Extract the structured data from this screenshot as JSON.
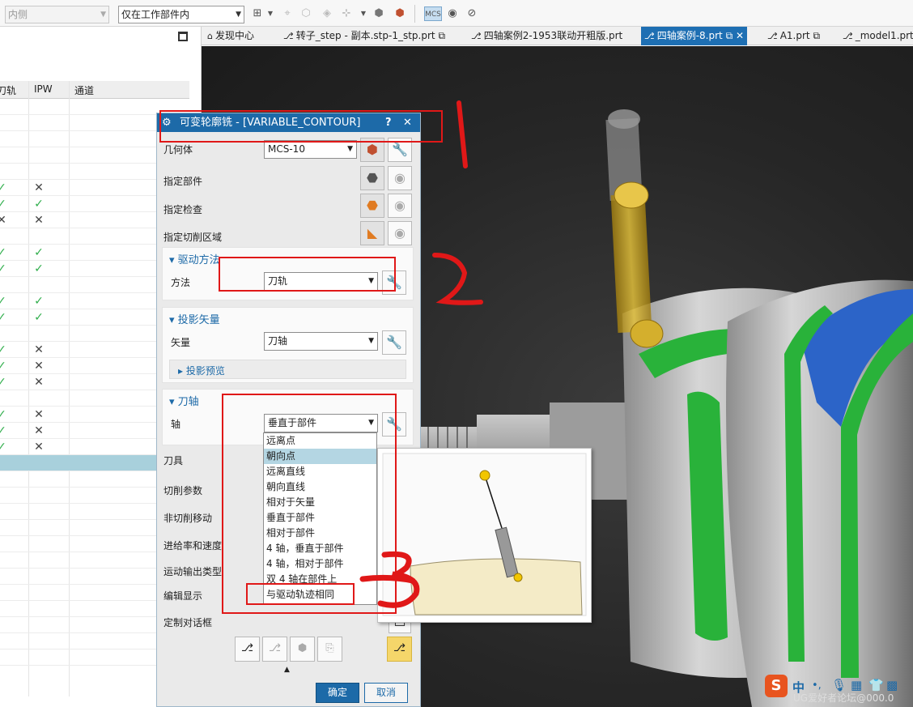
{
  "toolbar": {
    "filter_type": "内侧",
    "selection_scope": "仅在工作部件内"
  },
  "navigator": {
    "columns": [
      "刀轨",
      "IPW",
      "通道"
    ],
    "rows": [
      {
        "path": "",
        "ipw": ""
      },
      {
        "path": "",
        "ipw": ""
      },
      {
        "path": "",
        "ipw": ""
      },
      {
        "path": "",
        "ipw": ""
      },
      {
        "path": "",
        "ipw": ""
      },
      {
        "path": "✓",
        "ipw": "✕"
      },
      {
        "path": "✓",
        "ipw": "✓"
      },
      {
        "path": "✕",
        "ipw": "✕"
      },
      {
        "path": "",
        "ipw": ""
      },
      {
        "path": "✓",
        "ipw": "✓"
      },
      {
        "path": "✓",
        "ipw": "✓"
      },
      {
        "path": "",
        "ipw": ""
      },
      {
        "path": "✓",
        "ipw": "✓"
      },
      {
        "path": "✓",
        "ipw": "✓"
      },
      {
        "path": "",
        "ipw": ""
      },
      {
        "path": "✓",
        "ipw": "✕"
      },
      {
        "path": "✓",
        "ipw": "✕"
      },
      {
        "path": "✓",
        "ipw": "✕"
      },
      {
        "path": "",
        "ipw": ""
      },
      {
        "path": "✓",
        "ipw": "✕"
      },
      {
        "path": "✓",
        "ipw": "✕"
      },
      {
        "path": "✓",
        "ipw": "✕"
      },
      {
        "path": "",
        "ipw": "",
        "selected": true
      },
      {
        "path": "",
        "ipw": ""
      },
      {
        "path": "",
        "ipw": ""
      },
      {
        "path": "",
        "ipw": ""
      },
      {
        "path": "",
        "ipw": ""
      },
      {
        "path": "",
        "ipw": ""
      },
      {
        "path": "",
        "ipw": ""
      },
      {
        "path": "",
        "ipw": ""
      },
      {
        "path": "",
        "ipw": ""
      },
      {
        "path": "",
        "ipw": ""
      },
      {
        "path": "",
        "ipw": ""
      },
      {
        "path": "",
        "ipw": ""
      },
      {
        "path": "",
        "ipw": ""
      }
    ]
  },
  "tabs": [
    {
      "label": "发现中心",
      "icon": "discovery-icon",
      "active": false
    },
    {
      "label": "转子_step - 副本.stp-1_stp.prt",
      "icon": "part-icon",
      "active": false
    },
    {
      "label": "四轴案例2-1953联动开粗版.prt",
      "icon": "part-icon",
      "active": false
    },
    {
      "label": "四轴案例-8.prt",
      "icon": "part-icon",
      "active": true
    },
    {
      "label": "A1.prt",
      "icon": "part-icon",
      "active": false
    },
    {
      "label": "_model1.prt",
      "icon": "part-icon",
      "active": false
    }
  ],
  "dialog": {
    "title": "可变轮廓铣 - [VARIABLE_CONTOUR]",
    "geometry_label": "几何体",
    "geometry_value": "MCS-10",
    "specify_part": "指定部件",
    "specify_check": "指定检查",
    "specify_cut_area": "指定切削区域",
    "drive_method": {
      "title": "驱动方法",
      "method_label": "方法",
      "method_value": "刀轨"
    },
    "projection_vector": {
      "title": "投影矢量",
      "vector_label": "矢量",
      "vector_value": "刀轴",
      "preview_label": "投影预览"
    },
    "tool_axis": {
      "title": "刀轴",
      "axis_label": "轴",
      "axis_value": "垂直于部件",
      "options": [
        "远离点",
        "朝向点",
        "远离直线",
        "朝向直线",
        "相对于矢量",
        "垂直于部件",
        "相对于部件",
        "4 轴，垂直于部件",
        "4 轴，相对于部件",
        "双 4 轴在部件上",
        "与驱动轨迹相同"
      ],
      "highlighted_option": "朝向点"
    },
    "tool": "刀具",
    "cut_params": "切削参数",
    "non_cut_moves": "非切削移动",
    "feeds_speeds": "进给率和速度",
    "motion_output": "运动输出类型",
    "edit_display": "编辑显示",
    "customize_dialog": "定制对话框",
    "ok": "确定",
    "cancel": "取消"
  },
  "annotations": [
    "1",
    "2",
    "3"
  ],
  "watermark": "UG爱好者论坛@000.0",
  "ime_label": "中",
  "colors": {
    "accent": "#1d6aa8",
    "check_green": "#2fae4b",
    "annotation_red": "#e01818",
    "tool_yellow": "#d9b42a",
    "surface_green": "#29b23a",
    "surface_blue": "#2c64c8"
  }
}
